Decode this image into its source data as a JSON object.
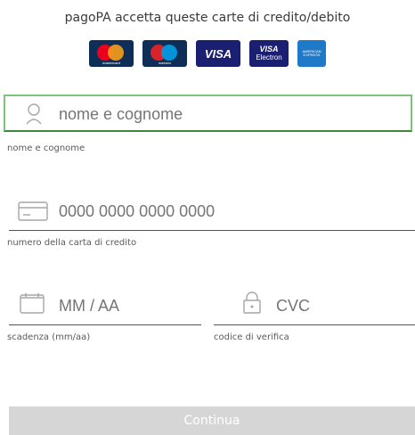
{
  "header": {
    "accepted_cards_text": "pagoPA accetta queste carte di credito/debito"
  },
  "cards": {
    "mastercard_label": "mastercard",
    "maestro_label": "maestro",
    "visa_label": "VISA",
    "visa_electron_line1": "VISA",
    "visa_electron_line2": "Electron",
    "amex_label": "AMERICAN EXPRESS"
  },
  "form": {
    "name": {
      "placeholder": "nome e cognome",
      "label": "nome e cognome"
    },
    "card_number": {
      "placeholder": "0000 0000 0000 0000",
      "label": "numero della carta di credito"
    },
    "expiry": {
      "placeholder": "MM / AA",
      "label": "scadenza (mm/aa)"
    },
    "cvc": {
      "placeholder": "CVC",
      "label": "codice di verifica"
    }
  },
  "actions": {
    "continue_label": "Continua"
  },
  "colors": {
    "focus_border": "#7dc27d",
    "button_disabled": "#d6d6d6"
  }
}
